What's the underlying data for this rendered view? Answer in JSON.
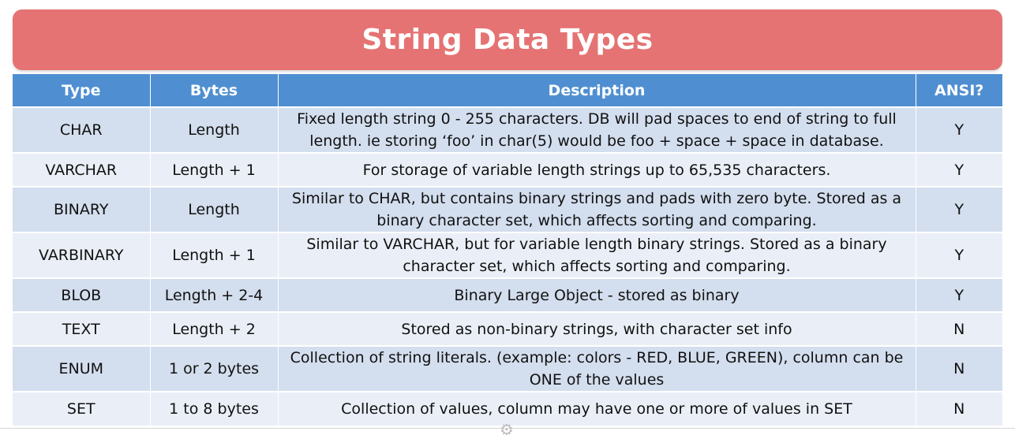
{
  "header": {
    "title": "String Data Types"
  },
  "table": {
    "columns": [
      "Type",
      "Bytes",
      "Description",
      "ANSI?"
    ],
    "rows": [
      {
        "type": "CHAR",
        "bytes": "Length",
        "description": "Fixed length string 0 - 255 characters. DB will pad spaces to end of string to full length. ie storing ‘foo’ in char(5) would be foo + space + space in database.",
        "ansi": "Y"
      },
      {
        "type": "VARCHAR",
        "bytes": "Length + 1",
        "description": "For storage of variable length strings up to 65,535 characters.",
        "ansi": "Y"
      },
      {
        "type": "BINARY",
        "bytes": "Length",
        "description": "Similar to CHAR, but contains binary strings and pads with zero byte. Stored as a binary character set, which affects sorting and comparing.",
        "ansi": "Y"
      },
      {
        "type": "VARBINARY",
        "bytes": "Length + 1",
        "description": "Similar to VARCHAR, but for variable length binary strings. Stored as a binary character set, which affects sorting and comparing.",
        "ansi": "Y"
      },
      {
        "type": "BLOB",
        "bytes": "Length + 2-4",
        "description": "Binary Large Object - stored as binary",
        "ansi": "Y"
      },
      {
        "type": "TEXT",
        "bytes": "Length + 2",
        "description": "Stored as non-binary strings, with character set info",
        "ansi": "N"
      },
      {
        "type": "ENUM",
        "bytes": "1 or 2 bytes",
        "description": "Collection of string literals. (example: colors - RED, BLUE, GREEN), column can be ONE of the values",
        "ansi": "N"
      },
      {
        "type": "SET",
        "bytes": "1 to 8 bytes",
        "description": "Collection of values, column may have one or more of values in SET",
        "ansi": "N"
      }
    ]
  },
  "colors": {
    "banner": "#e57373",
    "header_row": "#4f8fd1",
    "row_dark": "#d3deee",
    "row_light": "#eaeff7"
  }
}
